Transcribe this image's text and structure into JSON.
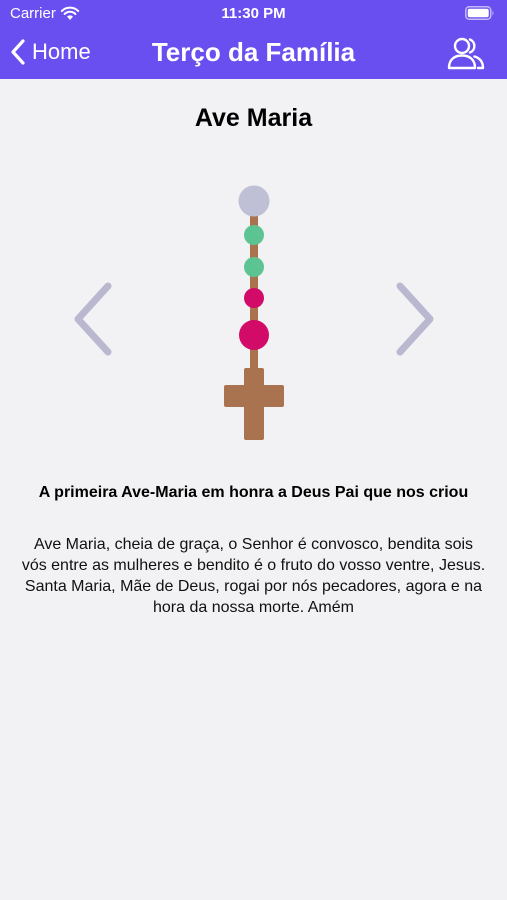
{
  "status_bar": {
    "carrier": "Carrier",
    "time": "11:30 PM"
  },
  "nav": {
    "back_label": "Home",
    "title": "Terço da Família"
  },
  "prayer": {
    "title": "Ave Maria",
    "subtitle": "A primeira Ave-Maria em honra a Deus Pai que nos criou",
    "text": "Ave Maria, cheia de graça, o Senhor é convosco, bendita sois vós entre as mulheres e bendito é o fruto do vosso ventre, Jesus. Santa Maria, Mãe de Deus, rogai por nós pecadores, agora e na hora da nossa morte. Amém"
  },
  "colors": {
    "header": "#6a4ff0",
    "arrow": "#b9b8d0",
    "bead_top": "#bfc0d6",
    "bead_green": "#5cc393",
    "bead_magenta": "#d10b67",
    "string": "#a9734f",
    "cross": "#a9734f"
  },
  "icons": {
    "wifi": "wifi-icon",
    "battery": "battery-icon",
    "back": "chevron-left-icon",
    "users": "users-icon",
    "prev": "chevron-left-arrow-icon",
    "next": "chevron-right-arrow-icon",
    "cross": "cross-icon"
  }
}
